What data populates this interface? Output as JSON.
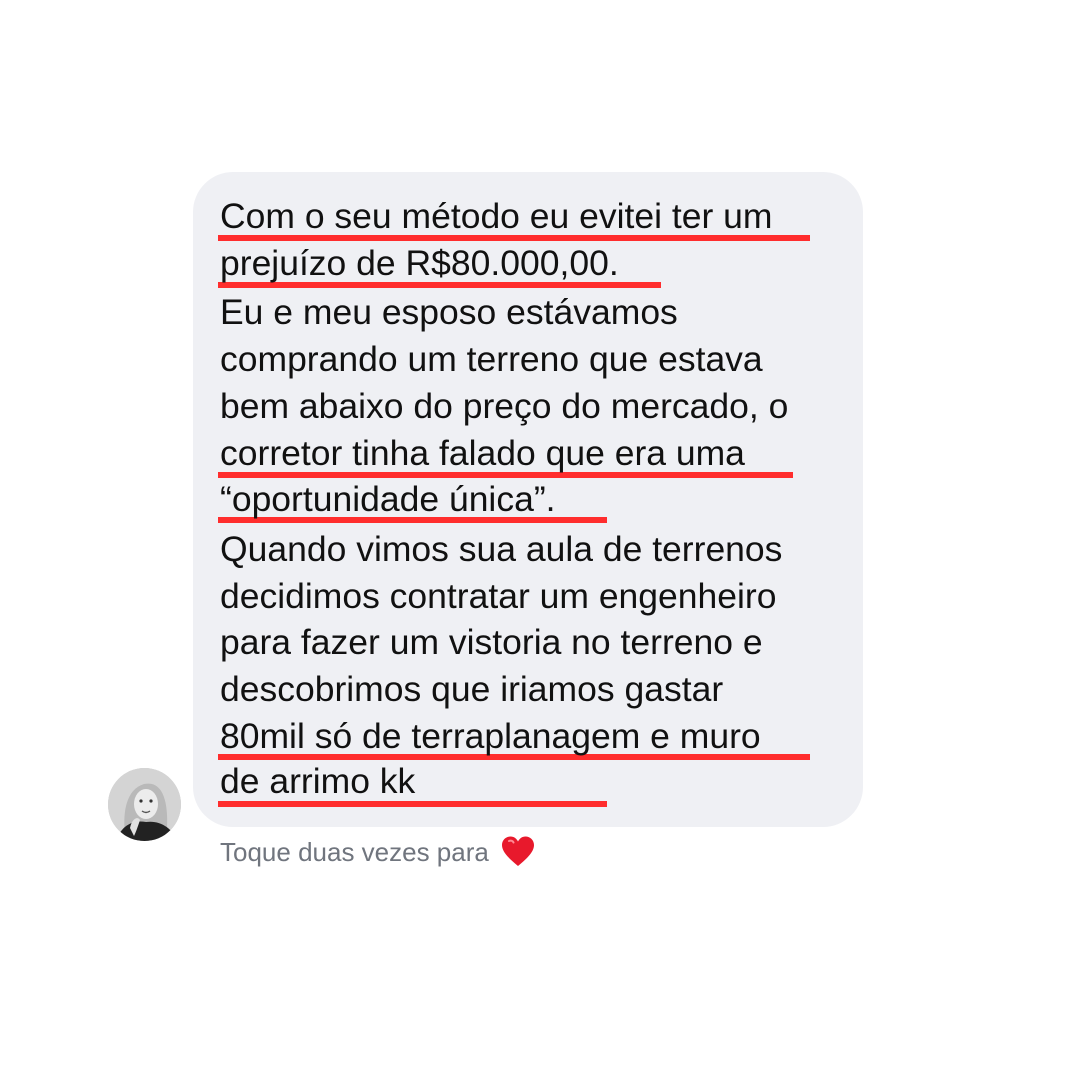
{
  "message": {
    "lines": [
      "Com o seu método eu evitei ter um",
      "prejuízo de R$80.000,00.",
      "Eu e meu esposo estávamos",
      "comprando um terreno que estava",
      "bem abaixo do preço do mercado, o",
      "corretor tinha falado que era uma",
      "“oportunidade única”.",
      "Quando vimos sua aula de terrenos",
      "decidimos contratar um engenheiro",
      "para fazer um vistoria no terreno e",
      "descobrimos que iriamos gastar",
      "80mil só de terraplanagem e muro",
      "de arrimo kk"
    ],
    "highlighted_line_indices": [
      0,
      1,
      5,
      6,
      11,
      12
    ]
  },
  "caption": {
    "text": "Toque duas vezes para",
    "icon": "heart-icon"
  },
  "colors": {
    "bubble_background": "#eff0f4",
    "highlight_underline": "#ff2d2d",
    "text": "#111111",
    "caption_text": "#70757e",
    "heart": "#e8192c"
  }
}
